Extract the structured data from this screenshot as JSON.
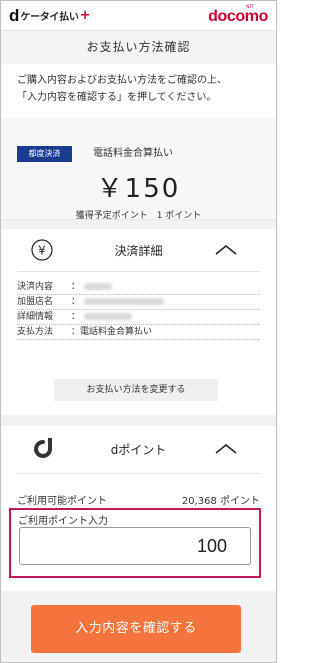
{
  "header": {
    "app_logo_d": "d",
    "app_logo_text": "ケータイ払い",
    "app_logo_plus": "+",
    "carrier_small": "NTT",
    "carrier_logo": "docomo"
  },
  "title": "お支払い方法確認",
  "intro": {
    "line1": "ご購入内容およびお支払い方法をご確認の上、",
    "line2": "「入力内容を確認する」を押してください。"
  },
  "amount": {
    "badge": "都度決済",
    "method": "電話料金合算払い",
    "price": "￥150",
    "points_earned": "獲得予定ポイント　1 ポイント"
  },
  "payment_details": {
    "icon_symbol": "¥",
    "title": "決済詳細",
    "rows": [
      {
        "label": "決済内容",
        "value": "："
      },
      {
        "label": "加盟店名",
        "value": "："
      },
      {
        "label": "詳細情報",
        "value": "："
      },
      {
        "label": "支払方法",
        "value": "：電話料金合算払い"
      }
    ],
    "change_button": "お支払い方法を変更する"
  },
  "dpoint": {
    "icon_symbol": "d",
    "title": "dポイント",
    "available_label": "ご利用可能ポイント",
    "available_value": "20,368 ポイント",
    "use_label": "ご利用ポイント入力",
    "use_value": "100"
  },
  "confirm_button": "入力内容を確認する",
  "colors": {
    "accent_orange": "#f5733d",
    "badge_navy": "#1b3b8f",
    "docomo_red": "#cc0033",
    "highlight_border": "#c2185b"
  }
}
